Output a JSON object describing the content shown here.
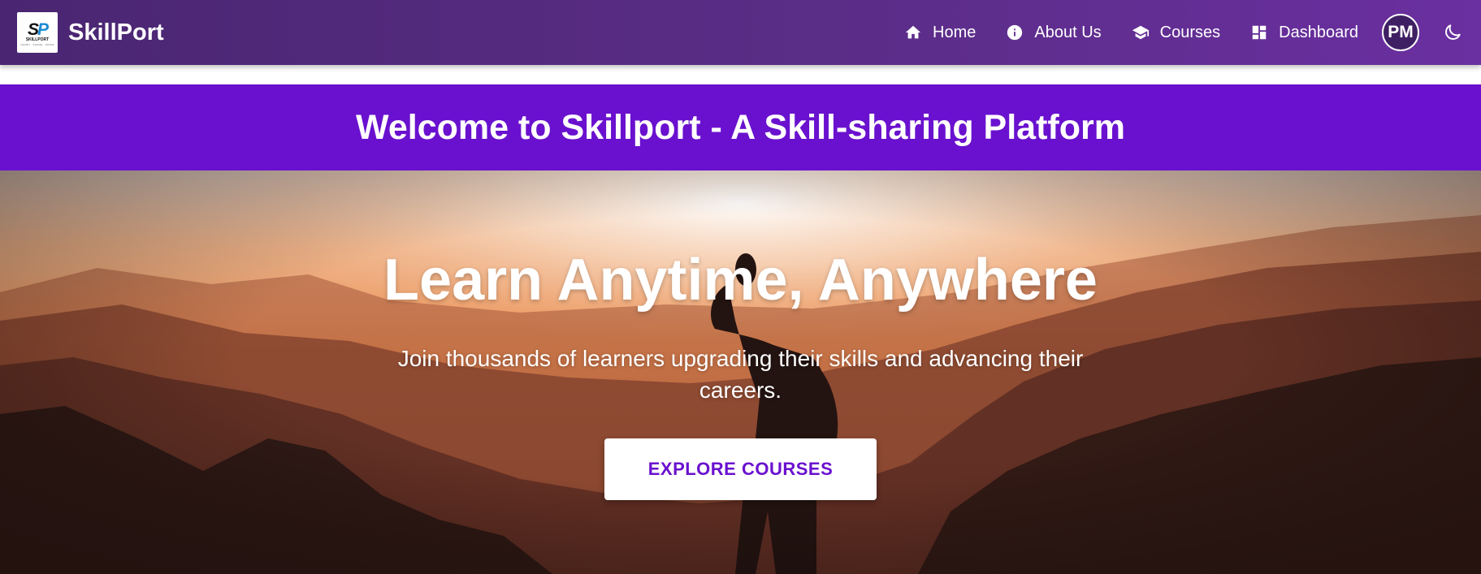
{
  "brand": {
    "name": "SkillPort",
    "logo_initial_s": "S",
    "logo_initial_p": "P",
    "logo_word": "SKILLPORT",
    "logo_tagline": "LEARN · SHARE · GROW"
  },
  "nav": {
    "items": [
      {
        "label": "Home",
        "icon": "home-icon"
      },
      {
        "label": "About Us",
        "icon": "info-icon"
      },
      {
        "label": "Courses",
        "icon": "graduation-cap-icon"
      },
      {
        "label": "Dashboard",
        "icon": "dashboard-icon"
      }
    ],
    "avatar_initials": "PM",
    "theme_toggle_icon": "moon-icon"
  },
  "welcome": {
    "title": "Welcome to Skillport - A Skill-sharing Platform"
  },
  "hero": {
    "title": "Learn Anytime, Anywhere",
    "subtitle": "Join thousands of learners upgrading their skills and advancing their careers.",
    "cta_label": "EXPLORE COURSES"
  },
  "colors": {
    "nav_gradient_start": "#4a2672",
    "nav_gradient_end": "#6a2fa0",
    "banner": "#6a11cf",
    "cta_text": "#6a11cf"
  }
}
